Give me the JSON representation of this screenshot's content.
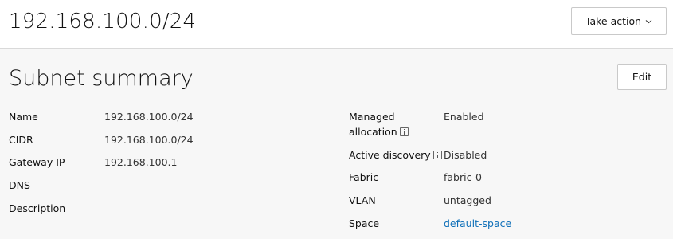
{
  "header": {
    "title": "192.168.100.0/24",
    "take_action_label": "Take action"
  },
  "summary": {
    "title": "Subnet summary",
    "edit_label": "Edit",
    "left": [
      {
        "label": "Name",
        "value": "192.168.100.0/24"
      },
      {
        "label": "CIDR",
        "value": "192.168.100.0/24"
      },
      {
        "label": "Gateway IP",
        "value": "192.168.100.1"
      },
      {
        "label": "DNS",
        "value": ""
      },
      {
        "label": "Description",
        "value": ""
      }
    ],
    "right": [
      {
        "label_line1": "Managed",
        "label_line2": "allocation",
        "value": "Enabled"
      },
      {
        "label": "Active discovery",
        "value": "Disabled"
      },
      {
        "label": "Fabric",
        "value": "fabric-0"
      },
      {
        "label": "VLAN",
        "value": "untagged"
      },
      {
        "label": "Space",
        "value": "default-space"
      }
    ]
  },
  "icons": {
    "take_action_chevron": "chevron-down-icon",
    "managed_allocation_info": "info-icon",
    "active_discovery_info": "info-icon"
  },
  "colors": {
    "link": "#0e6fb8",
    "header_bg": "#ffffff",
    "page_bg": "#f7f7f7"
  }
}
